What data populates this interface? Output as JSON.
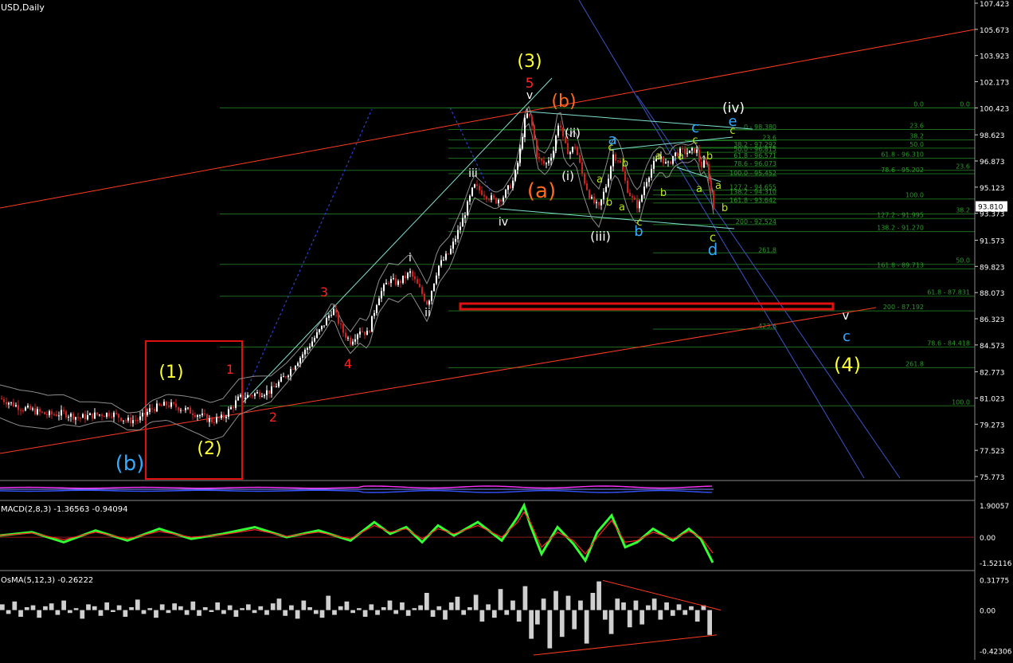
{
  "window": {
    "title": "USD,Daily"
  },
  "colors": {
    "background": "#000000",
    "candle_up": "#ffffff",
    "candle_down": "#cc2222",
    "band": "#8c8c8c",
    "fib_grid": "#1d6b1d",
    "trend_red": "#ff3b1f",
    "channel_blue": "#3a55c8",
    "teal_line": "#7fe0d0",
    "macd_main": "#33ff33",
    "macd_signal": "#ff2222",
    "osma": "#cfcfcf",
    "axis_text": "#ffffff",
    "support_box": "#e01010",
    "label_yellow": "#ffff33",
    "label_red": "#ff2020",
    "label_orange": "#ff6a1a",
    "label_cyan": "#33aaff",
    "label_lime": "#b8e61e",
    "label_white": "#ffffff"
  },
  "chart_data": [
    {
      "type": "candlestick",
      "name": "price",
      "title": "USD,Daily",
      "ylim": [
        75.773,
        107.423
      ],
      "y_ticks": [
        "107.423",
        "105.673",
        "103.923",
        "102.173",
        "100.423",
        "98.623",
        "96.873",
        "95.123",
        "93.373",
        "91.573",
        "89.823",
        "88.073",
        "86.323",
        "84.573",
        "82.773",
        "81.023",
        "79.273",
        "77.523",
        "75.773"
      ],
      "current_price": "93.810",
      "anchors": [
        [
          0,
          81.0
        ],
        [
          25,
          80.4
        ],
        [
          40,
          80.2
        ],
        [
          60,
          79.9
        ],
        [
          80,
          80.0
        ],
        [
          100,
          79.7
        ],
        [
          120,
          79.9
        ],
        [
          140,
          80.0
        ],
        [
          160,
          79.5
        ],
        [
          175,
          79.6
        ],
        [
          190,
          80.3
        ],
        [
          210,
          80.6
        ],
        [
          230,
          80.3
        ],
        [
          250,
          79.9
        ],
        [
          265,
          79.5
        ],
        [
          280,
          79.7
        ],
        [
          300,
          81.0
        ],
        [
          320,
          81.3
        ],
        [
          340,
          81.5
        ],
        [
          360,
          82.6
        ],
        [
          385,
          84.3
        ],
        [
          405,
          85.8
        ],
        [
          418,
          87.0
        ],
        [
          430,
          85.5
        ],
        [
          440,
          84.8
        ],
        [
          452,
          85.6
        ],
        [
          462,
          85.3
        ],
        [
          475,
          87.8
        ],
        [
          488,
          88.9
        ],
        [
          500,
          88.7
        ],
        [
          515,
          89.4
        ],
        [
          528,
          88.2
        ],
        [
          537,
          87.3
        ],
        [
          550,
          89.8
        ],
        [
          565,
          90.8
        ],
        [
          580,
          92.8
        ],
        [
          595,
          95.2
        ],
        [
          610,
          94.6
        ],
        [
          622,
          94.2
        ],
        [
          632,
          94.5
        ],
        [
          645,
          95.6
        ],
        [
          652,
          97.2
        ],
        [
          658,
          99.4
        ],
        [
          663,
          100.1
        ],
        [
          668,
          99.2
        ],
        [
          675,
          97.0
        ],
        [
          685,
          96.6
        ],
        [
          695,
          97.6
        ],
        [
          702,
          99.7
        ],
        [
          708,
          98.0
        ],
        [
          715,
          97.4
        ],
        [
          722,
          97.9
        ],
        [
          732,
          95.8
        ],
        [
          742,
          94.3
        ],
        [
          752,
          93.7
        ],
        [
          762,
          95.4
        ],
        [
          770,
          97.3
        ],
        [
          778,
          96.9
        ],
        [
          787,
          95.1
        ],
        [
          795,
          94.2
        ],
        [
          802,
          93.8
        ],
        [
          810,
          95.4
        ],
        [
          820,
          96.6
        ],
        [
          830,
          97.2
        ],
        [
          838,
          96.5
        ],
        [
          846,
          97.3
        ],
        [
          856,
          97.5
        ],
        [
          866,
          97.4
        ],
        [
          874,
          97.7
        ],
        [
          880,
          96.5
        ],
        [
          886,
          96.8
        ],
        [
          892,
          95.2
        ],
        [
          896,
          93.8
        ]
      ],
      "fib_levels": [
        {
          "x_start": 276,
          "label": "0.0",
          "value": 100.423,
          "label_x": 1218
        },
        {
          "x_start": 563,
          "label": "0.0",
          "value": 100.423,
          "label_x": 1160
        },
        {
          "x_start": 563,
          "label": "23.6",
          "value": 98.98,
          "label_x": 1160
        },
        {
          "x_start": 563,
          "label": "38.2",
          "value": 98.28,
          "label_x": 1160
        },
        {
          "x_start": 563,
          "label": "50.0",
          "value": 97.73,
          "label_x": 1160
        },
        {
          "x_start": 563,
          "label": "61.8 - 96.310",
          "value": 97.05,
          "label_x": 1160
        },
        {
          "x_start": 276,
          "label": "23.6",
          "value": 96.25,
          "label_x": 1218
        },
        {
          "x_start": 563,
          "label": "78.6 - 95.202",
          "value": 96.02,
          "label_x": 1160
        },
        {
          "x_start": 563,
          "label": "100.0",
          "value": 94.33,
          "label_x": 1160
        },
        {
          "x_start": 276,
          "label": "38.2",
          "value": 93.33,
          "label_x": 1218
        },
        {
          "x_start": 563,
          "label": "127.2 - 91.995",
          "value": 93.02,
          "label_x": 1160
        },
        {
          "x_start": 563,
          "label": "138.2 - 91.270",
          "value": 92.15,
          "label_x": 1160
        },
        {
          "x_start": 276,
          "label": "50.0",
          "value": 89.96,
          "label_x": 1218
        },
        {
          "x_start": 563,
          "label": "161.8 - 89.713",
          "value": 89.66,
          "label_x": 1160
        },
        {
          "x_start": 276,
          "label": "61.8 - 87.831",
          "value": 87.83,
          "label_x": 1218
        },
        {
          "x_start": 563,
          "label": "200 - 87.192",
          "value": 86.85,
          "label_x": 1160
        },
        {
          "x_start": 276,
          "label": "78.6 - 84.418",
          "value": 84.43,
          "label_x": 1218
        },
        {
          "x_start": 563,
          "label": "261.8",
          "value": 83.05,
          "label_x": 1160
        },
        {
          "x_start": 276,
          "label": "100.0",
          "value": 80.5,
          "label_x": 1218
        }
      ],
      "sub_fib_levels": [
        {
          "x_start": 620,
          "label": "0 - 98.380",
          "value": 98.95,
          "label_x": 975
        },
        {
          "x_start": 860,
          "label": "23.6",
          "value": 98.23,
          "label_x": 975
        },
        {
          "x_start": 860,
          "label": "38.2 - 97.292",
          "value": 97.78,
          "label_x": 975
        },
        {
          "x_start": 860,
          "label": "50.0 - 96.815",
          "value": 97.45,
          "label_x": 975
        },
        {
          "x_start": 820,
          "label": "61.8 - 96.571",
          "value": 97.04,
          "label_x": 975
        },
        {
          "x_start": 820,
          "label": "78.6 - 96.073",
          "value": 96.5,
          "label_x": 975
        },
        {
          "x_start": 820,
          "label": "100.0 - 95.452",
          "value": 95.87,
          "label_x": 975
        },
        {
          "x_start": 820,
          "label": "127.2 - 94.655",
          "value": 94.92,
          "label_x": 975
        },
        {
          "x_start": 820,
          "label": "138.2 - 94.310",
          "value": 94.6,
          "label_x": 975
        },
        {
          "x_start": 820,
          "label": "161.8 - 93.642",
          "value": 94.06,
          "label_x": 975
        },
        {
          "x_start": 820,
          "label": "200 - 92.524",
          "value": 92.62,
          "label_x": 975
        },
        {
          "x_start": 820,
          "label": "261.8",
          "value": 90.73,
          "label_x": 975
        },
        {
          "x_start": 820,
          "label": "423.6",
          "value": 85.63,
          "label_x": 975
        }
      ],
      "wave_labels": [
        {
          "text": "(3)",
          "x": 665,
          "y": 84,
          "size": 22,
          "color": "#ffff33"
        },
        {
          "text": "5",
          "x": 665,
          "y": 110,
          "size": 17,
          "color": "#ff2020"
        },
        {
          "text": "v",
          "x": 665,
          "y": 124,
          "size": 14,
          "color": "#ffffff"
        },
        {
          "text": "(b)",
          "x": 708,
          "y": 134,
          "size": 22,
          "color": "#ff6a1a"
        },
        {
          "text": "(ii)",
          "x": 719,
          "y": 172,
          "size": 15,
          "color": "#ffffff"
        },
        {
          "text": "(i)",
          "x": 713,
          "y": 226,
          "size": 15,
          "color": "#ffffff"
        },
        {
          "text": "(a)",
          "x": 680,
          "y": 248,
          "size": 26,
          "color": "#ff6a1a"
        },
        {
          "text": "iii",
          "x": 594,
          "y": 222,
          "size": 14,
          "color": "#ffffff"
        },
        {
          "text": "iv",
          "x": 632,
          "y": 283,
          "size": 14,
          "color": "#ffffff"
        },
        {
          "text": "i",
          "x": 515,
          "y": 328,
          "size": 14,
          "color": "#ffffff"
        },
        {
          "text": "ii",
          "x": 537,
          "y": 397,
          "size": 14,
          "color": "#ffffff"
        },
        {
          "text": "(iii)",
          "x": 754,
          "y": 302,
          "size": 16,
          "color": "#ffffff"
        },
        {
          "text": "(iv)",
          "x": 921,
          "y": 141,
          "size": 17,
          "color": "#ffffff"
        },
        {
          "text": "e",
          "x": 920,
          "y": 158,
          "size": 18,
          "color": "#33aaff"
        },
        {
          "text": "c",
          "x": 920,
          "y": 168,
          "size": 13,
          "color": "#b8e61e"
        },
        {
          "text": "c",
          "x": 873,
          "y": 166,
          "size": 18,
          "color": "#33aaff"
        },
        {
          "text": "c",
          "x": 873,
          "y": 180,
          "size": 13,
          "color": "#b8e61e"
        },
        {
          "text": "a",
          "x": 769,
          "y": 181,
          "size": 18,
          "color": "#33aaff"
        },
        {
          "text": "c",
          "x": 767,
          "y": 189,
          "size": 13,
          "color": "#b8e61e"
        },
        {
          "text": "b",
          "x": 785,
          "y": 209,
          "size": 13,
          "color": "#b8e61e"
        },
        {
          "text": "a",
          "x": 753,
          "y": 229,
          "size": 13,
          "color": "#b8e61e"
        },
        {
          "text": "b",
          "x": 765,
          "y": 258,
          "size": 13,
          "color": "#b8e61e"
        },
        {
          "text": "a",
          "x": 781,
          "y": 264,
          "size": 13,
          "color": "#b8e61e"
        },
        {
          "text": "c",
          "x": 803,
          "y": 283,
          "size": 13,
          "color": "#b8e61e"
        },
        {
          "text": "b",
          "x": 802,
          "y": 296,
          "size": 18,
          "color": "#33aaff"
        },
        {
          "text": "a",
          "x": 827,
          "y": 200,
          "size": 13,
          "color": "#b8e61e"
        },
        {
          "text": "b",
          "x": 833,
          "y": 246,
          "size": 13,
          "color": "#b8e61e"
        },
        {
          "text": "a",
          "x": 855,
          "y": 200,
          "size": 13,
          "color": "#b8e61e"
        },
        {
          "text": "b",
          "x": 891,
          "y": 200,
          "size": 13,
          "color": "#b8e61e"
        },
        {
          "text": "a",
          "x": 878,
          "y": 241,
          "size": 13,
          "color": "#b8e61e"
        },
        {
          "text": "a",
          "x": 902,
          "y": 237,
          "size": 13,
          "color": "#b8e61e"
        },
        {
          "text": "b",
          "x": 910,
          "y": 265,
          "size": 13,
          "color": "#b8e61e"
        },
        {
          "text": "c",
          "x": 895,
          "y": 303,
          "size": 15,
          "color": "#b8e61e"
        },
        {
          "text": "d",
          "x": 895,
          "y": 320,
          "size": 20,
          "color": "#33aaff"
        },
        {
          "text": "3",
          "x": 407,
          "y": 372,
          "size": 16,
          "color": "#ff2020"
        },
        {
          "text": "4",
          "x": 437,
          "y": 462,
          "size": 16,
          "color": "#ff2020"
        },
        {
          "text": "1",
          "x": 289,
          "y": 469,
          "size": 16,
          "color": "#ff2020"
        },
        {
          "text": "2",
          "x": 343,
          "y": 529,
          "size": 16,
          "color": "#ff2020"
        },
        {
          "text": "(1)",
          "x": 215,
          "y": 474,
          "size": 22,
          "color": "#ffff33"
        },
        {
          "text": "(2)",
          "x": 263,
          "y": 570,
          "size": 22,
          "color": "#ffff33"
        },
        {
          "text": "(b)",
          "x": 163,
          "y": 590,
          "size": 26,
          "color": "#33aaff"
        },
        {
          "text": "v",
          "x": 1062,
          "y": 401,
          "size": 15,
          "color": "#ffffff"
        },
        {
          "text": "c",
          "x": 1063,
          "y": 428,
          "size": 18,
          "color": "#33aaff"
        },
        {
          "text": "(4)",
          "x": 1064,
          "y": 466,
          "size": 24,
          "color": "#ffff33"
        }
      ]
    },
    {
      "type": "line",
      "name": "macd",
      "title": "MACD(2,8,3) -1.36563 -0.94094",
      "y_ticks": [
        "1.90057",
        "0.00",
        "-1.52116"
      ],
      "ylim": [
        -1.9,
        2.1
      ],
      "x": [
        0,
        40,
        80,
        120,
        160,
        200,
        240,
        280,
        320,
        360,
        400,
        440,
        470,
        490,
        510,
        530,
        550,
        570,
        600,
        630,
        650,
        658,
        666,
        680,
        700,
        720,
        735,
        750,
        768,
        785,
        800,
        820,
        845,
        865,
        880,
        895
      ],
      "series": [
        {
          "name": "MACD",
          "values": [
            0.1,
            0.3,
            -0.3,
            0.4,
            -0.2,
            0.5,
            -0.1,
            0.2,
            0.6,
            0.0,
            0.4,
            -0.2,
            0.9,
            0.2,
            0.6,
            -0.3,
            0.7,
            0.1,
            0.9,
            -0.2,
            1.2,
            1.9,
            0.7,
            -1.0,
            0.6,
            -0.4,
            -1.4,
            0.3,
            1.3,
            -0.6,
            -0.3,
            0.5,
            -0.2,
            0.5,
            -0.1,
            -1.52
          ]
        },
        {
          "name": "Signal",
          "values": [
            0.1,
            0.25,
            -0.15,
            0.3,
            -0.1,
            0.35,
            0.0,
            0.15,
            0.45,
            0.05,
            0.3,
            -0.1,
            0.7,
            0.3,
            0.5,
            -0.1,
            0.5,
            0.2,
            0.7,
            0.0,
            0.9,
            1.5,
            0.9,
            -0.6,
            0.3,
            -0.2,
            -1.0,
            0.0,
            1.0,
            -0.3,
            -0.2,
            0.3,
            -0.1,
            0.35,
            0.0,
            -0.94
          ]
        }
      ]
    },
    {
      "type": "bar",
      "name": "osma",
      "title": "OsMA(5,12,3) -0.26222",
      "y_ticks": [
        "0.31775",
        "0.00",
        "-0.42306"
      ],
      "ylim": [
        -0.47,
        0.38
      ],
      "values": [
        0.06,
        -0.04,
        0.09,
        -0.07,
        0.03,
        0.05,
        -0.08,
        0.04,
        0.07,
        -0.05,
        0.1,
        -0.03,
        0.02,
        -0.09,
        0.06,
        0.04,
        -0.06,
        0.08,
        -0.02,
        0.05,
        -0.07,
        0.03,
        0.11,
        -0.04,
        0.02,
        -0.08,
        0.06,
        -0.03,
        0.07,
        0.04,
        -0.05,
        0.09,
        -0.06,
        0.03,
        -0.02,
        0.08,
        -0.04,
        0.05,
        -0.07,
        0.02,
        0.06,
        -0.03,
        0.04,
        -0.05,
        0.07,
        0.12,
        -0.06,
        0.05,
        -0.09,
        0.1,
        0.03,
        -0.04,
        -0.08,
        0.15,
        -0.05,
        0.04,
        0.09,
        -0.03,
        0.02,
        -0.07,
        0.06,
        -0.05,
        0.03,
        0.1,
        -0.04,
        0.08,
        -0.06,
        0.02,
        0.05,
        0.18,
        -0.07,
        0.04,
        -0.1,
        0.08,
        0.14,
        -0.05,
        0.03,
        0.16,
        -0.12,
        0.06,
        -0.08,
        0.22,
        -0.05,
        0.1,
        -0.12,
        0.25,
        -0.3,
        -0.15,
        0.12,
        -0.4,
        0.2,
        -0.28,
        0.15,
        -0.2,
        0.1,
        -0.35,
        0.18,
        0.3,
        -0.1,
        -0.25,
        0.12,
        0.08,
        -0.18,
        0.1,
        -0.15,
        0.05,
        0.12,
        -0.1,
        0.08,
        -0.06,
        0.06,
        -0.05,
        0.04,
        -0.12,
        0.05,
        -0.26
      ]
    }
  ]
}
